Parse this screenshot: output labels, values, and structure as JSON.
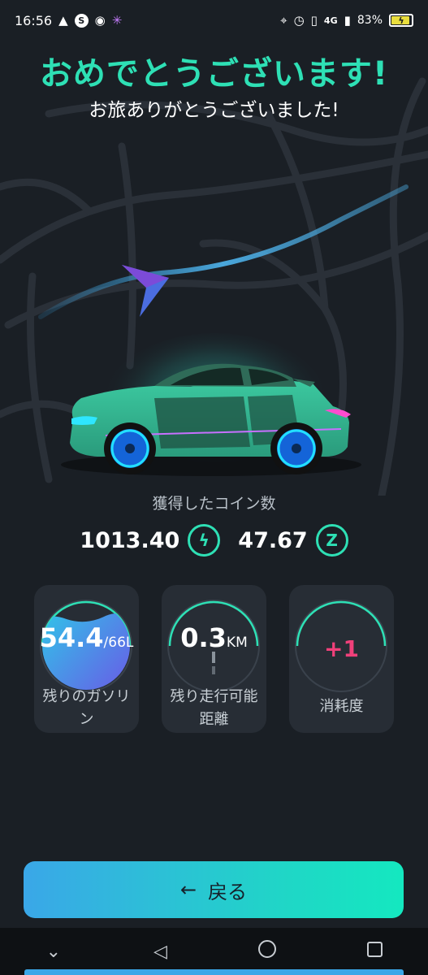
{
  "status_bar": {
    "time": "16:56",
    "network": "4G",
    "battery_percent": "83%"
  },
  "header": {
    "title": "おめでとうございます!",
    "subtitle": "お旅ありがとうございました!"
  },
  "coins": {
    "label": "獲得したコイン数",
    "primary_value": "1013.40",
    "primary_icon": "lightning-coin-icon",
    "secondary_value": "47.67",
    "secondary_icon": "z-coin-icon"
  },
  "stats": {
    "fuel": {
      "value": "54.4",
      "unit": "/66L",
      "label_line1": "残りのガソリ",
      "label_line2": "ン",
      "level_fraction": 0.824
    },
    "range": {
      "value": "0.3",
      "unit": "KM",
      "label_line1": "残り走行可能",
      "label_line2": "距離"
    },
    "wear": {
      "value": "+1",
      "label": "消耗度"
    }
  },
  "actions": {
    "back_label": "戻る"
  },
  "colors": {
    "accent": "#2ee0b5",
    "background": "#1a1f25",
    "card": "#272d35",
    "wear_value": "#f0407a",
    "button_start": "#3aa7e8",
    "button_end": "#14e8c0"
  }
}
